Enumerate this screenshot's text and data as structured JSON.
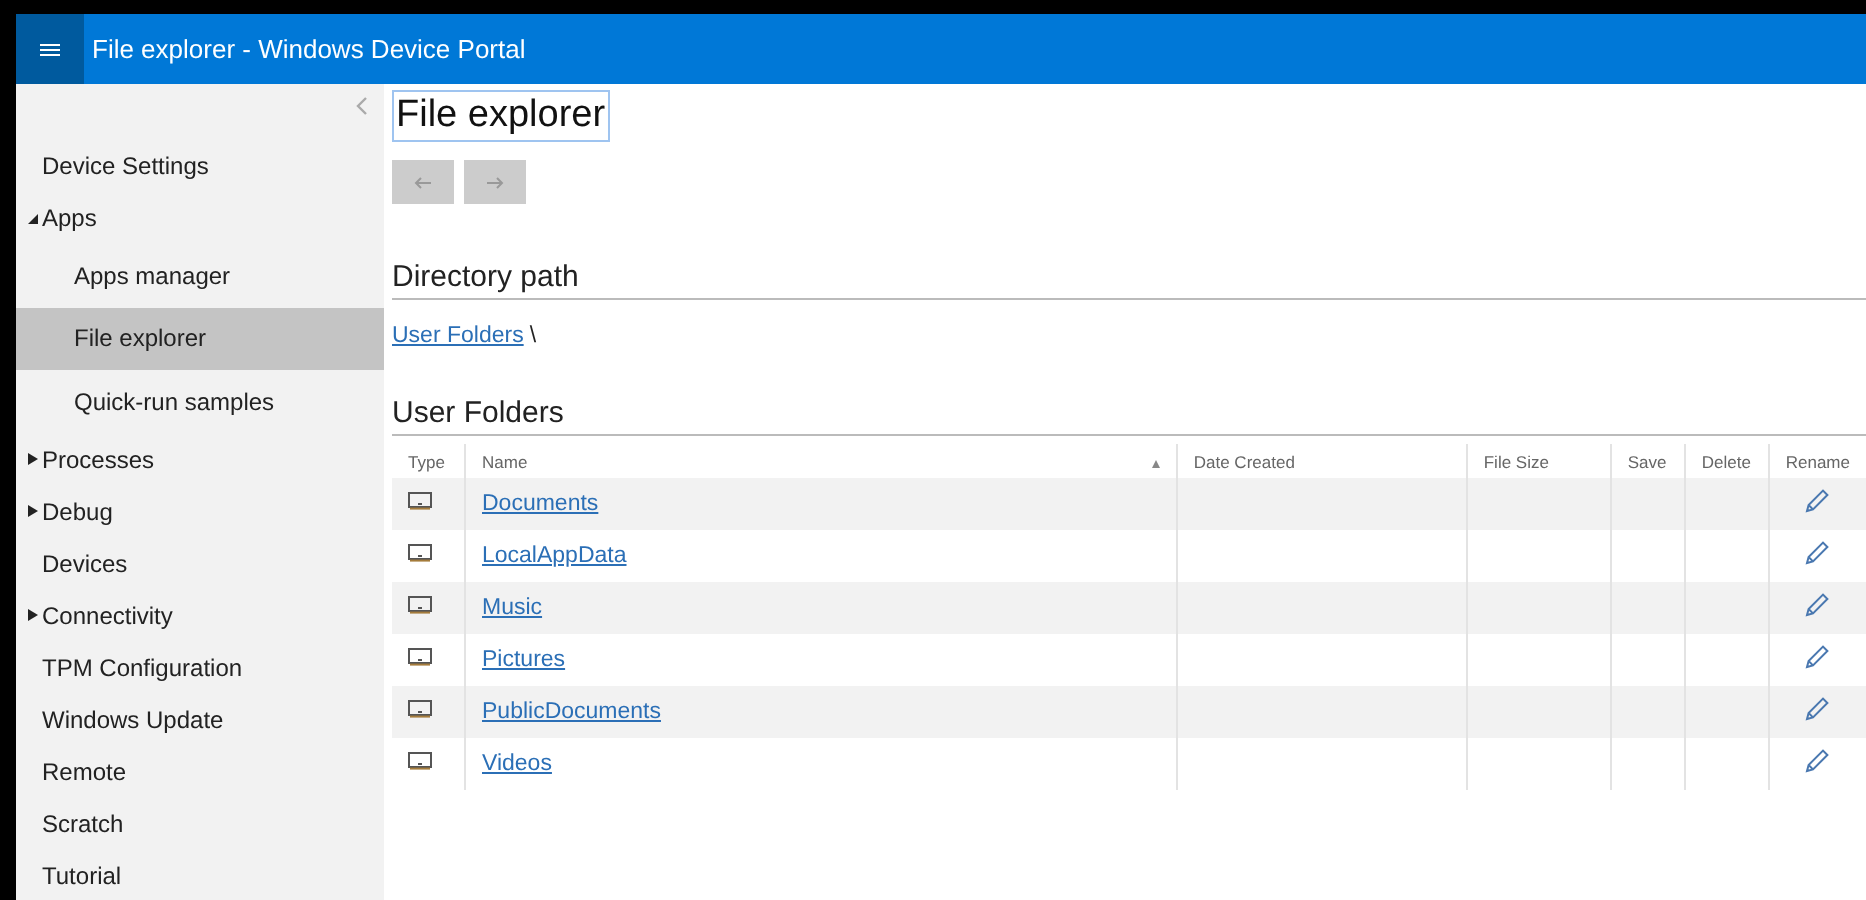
{
  "header": {
    "title": "File explorer - Windows Device Portal"
  },
  "sidebar": {
    "items": [
      {
        "label": "Device Settings",
        "kind": "page",
        "selected": false
      },
      {
        "label": "Apps",
        "kind": "group",
        "expanded": true,
        "selected": false,
        "children": [
          {
            "label": "Apps manager",
            "selected": false
          },
          {
            "label": "File explorer",
            "selected": true
          },
          {
            "label": "Quick-run samples",
            "selected": false
          }
        ]
      },
      {
        "label": "Processes",
        "kind": "group",
        "expanded": false,
        "selected": false
      },
      {
        "label": "Debug",
        "kind": "group",
        "expanded": false,
        "selected": false
      },
      {
        "label": "Devices",
        "kind": "page",
        "selected": false
      },
      {
        "label": "Connectivity",
        "kind": "group",
        "expanded": false,
        "selected": false
      },
      {
        "label": "TPM Configuration",
        "kind": "page",
        "selected": false
      },
      {
        "label": "Windows Update",
        "kind": "page",
        "selected": false
      },
      {
        "label": "Remote",
        "kind": "page",
        "selected": false
      },
      {
        "label": "Scratch",
        "kind": "page",
        "selected": false
      },
      {
        "label": "Tutorial",
        "kind": "page",
        "selected": false
      }
    ]
  },
  "page": {
    "title": "File explorer",
    "back": {
      "disabled": true
    },
    "forward": {
      "disabled": true
    },
    "directory_heading": "Directory path",
    "path_link": "User Folders",
    "path_separator": "\\",
    "folders_heading": "User Folders"
  },
  "table": {
    "columns": [
      "Type",
      "Name",
      "Date Created",
      "File Size",
      "Save",
      "Delete",
      "Rename"
    ],
    "rows": [
      {
        "name": "Documents"
      },
      {
        "name": "LocalAppData"
      },
      {
        "name": "Music"
      },
      {
        "name": "Pictures"
      },
      {
        "name": "PublicDocuments"
      },
      {
        "name": "Videos"
      }
    ]
  }
}
